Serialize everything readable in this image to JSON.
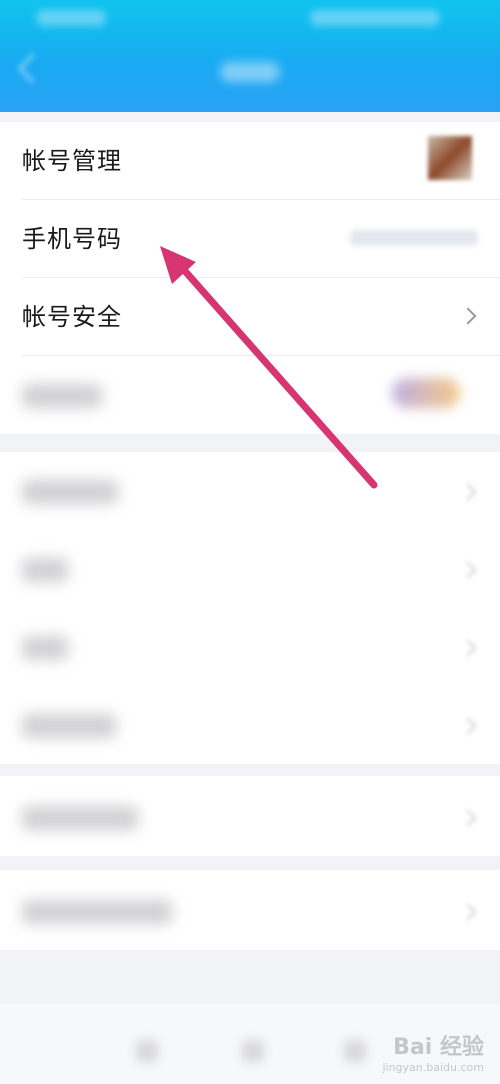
{
  "settings": {
    "items": [
      {
        "label": "帐号管理"
      },
      {
        "label": "手机号码"
      },
      {
        "label": "帐号安全"
      }
    ]
  },
  "annotation": {
    "arrow_color": "#d63572"
  },
  "watermark": {
    "main": "Bai 经验",
    "sub": "jingyan.baidu.com"
  },
  "colors": {
    "header": "#1aa9f2",
    "background": "#f2f3f6"
  },
  "icons": [
    "back-arrow-icon",
    "chevron-right-icon",
    "toggle-switch-icon"
  ]
}
